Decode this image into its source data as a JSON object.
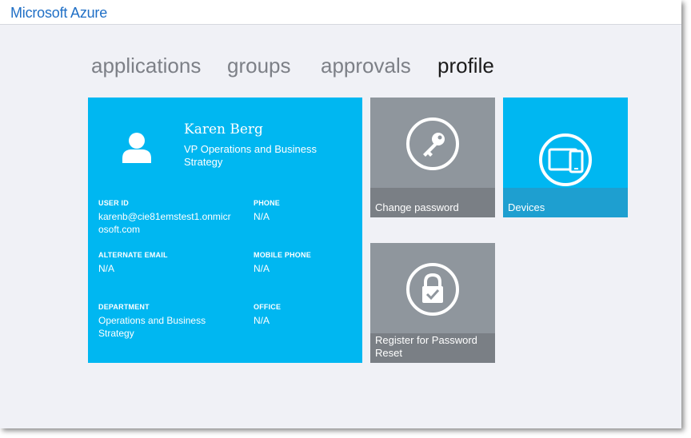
{
  "app": {
    "brand": "Microsoft Azure"
  },
  "nav": {
    "tabs": [
      {
        "label": "applications",
        "active": false
      },
      {
        "label": "groups",
        "active": false
      },
      {
        "label": "approvals",
        "active": false
      },
      {
        "label": "profile",
        "active": true
      }
    ]
  },
  "profile": {
    "name": "Karen Berg",
    "title": "VP Operations and Business Strategy",
    "icon": "user-icon",
    "fields": {
      "user_id": {
        "label": "USER ID",
        "value": "karenb@cie81emstest1.onmicrosoft.com"
      },
      "phone": {
        "label": "PHONE",
        "value": "N/A"
      },
      "alternate_email": {
        "label": "ALTERNATE EMAIL",
        "value": "N/A"
      },
      "mobile_phone": {
        "label": "MOBILE PHONE",
        "value": "N/A"
      },
      "department": {
        "label": "DEPARTMENT",
        "value": "Operations and Business Strategy"
      },
      "office": {
        "label": "OFFICE",
        "value": "N/A"
      }
    }
  },
  "tiles": {
    "change_password": {
      "label": "Change password",
      "icon": "key-icon"
    },
    "devices": {
      "label": "Devices",
      "icon": "devices-icon"
    },
    "register_reset": {
      "label": "Register for Password Reset",
      "icon": "lock-check-icon"
    }
  },
  "colors": {
    "brand": "#1f6fc6",
    "accent": "#00b7f1",
    "tile_gray": "#8f969d",
    "background": "#f0f1f6"
  }
}
